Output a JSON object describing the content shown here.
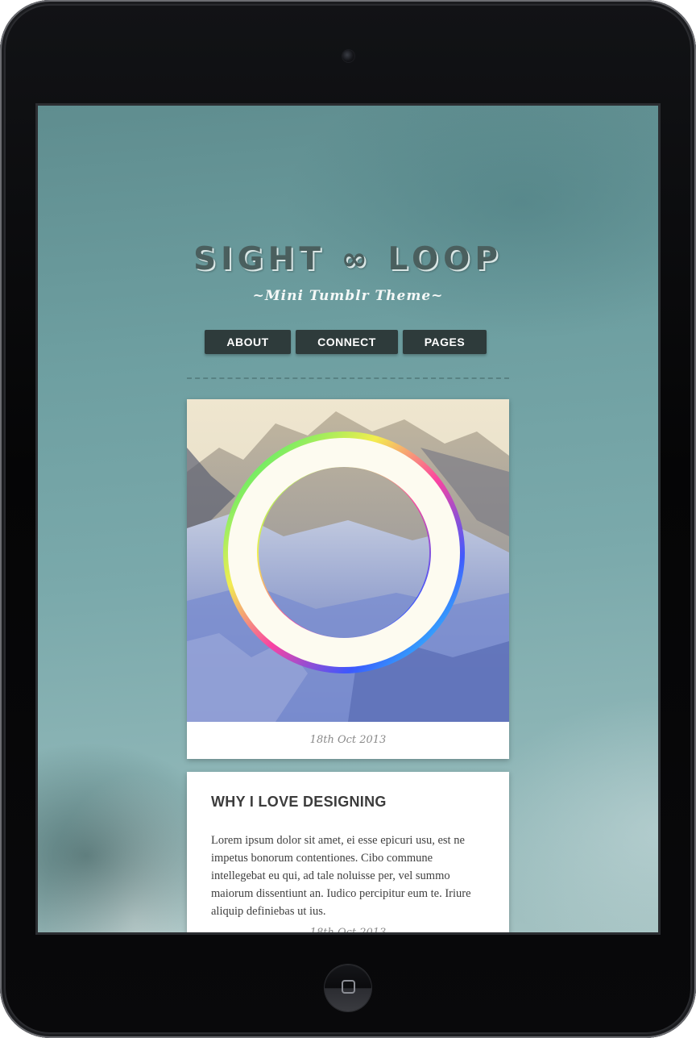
{
  "site": {
    "title": "SIGHT ∞ LOOP",
    "subtitle": "~Mini Tumblr Theme~"
  },
  "nav": {
    "items": [
      {
        "label": "ABOUT"
      },
      {
        "label": "CONNECT"
      },
      {
        "label": "PAGES"
      }
    ]
  },
  "posts": [
    {
      "type": "photo",
      "date": "18th Oct 2013"
    },
    {
      "type": "text",
      "title": "WHY I LOVE DESIGNING",
      "body": "Lorem ipsum dolor sit amet, ei esse epicuri usu, est ne impetus bonorum contentiones. Cibo commune intellegebat eu qui, ad tale noluisse per, vel summo maiorum dissentiunt an. Iudico percipitur eum te. Iriure aliquip definiebas ut ius.",
      "date": "18th Oct 2013"
    }
  ],
  "colors": {
    "nav_button_bg": "#2e3b3b",
    "title_color": "#4a5f5e",
    "card_bg": "#ffffff"
  },
  "icons": {
    "camera": "camera-icon",
    "home": "home-button-icon"
  }
}
